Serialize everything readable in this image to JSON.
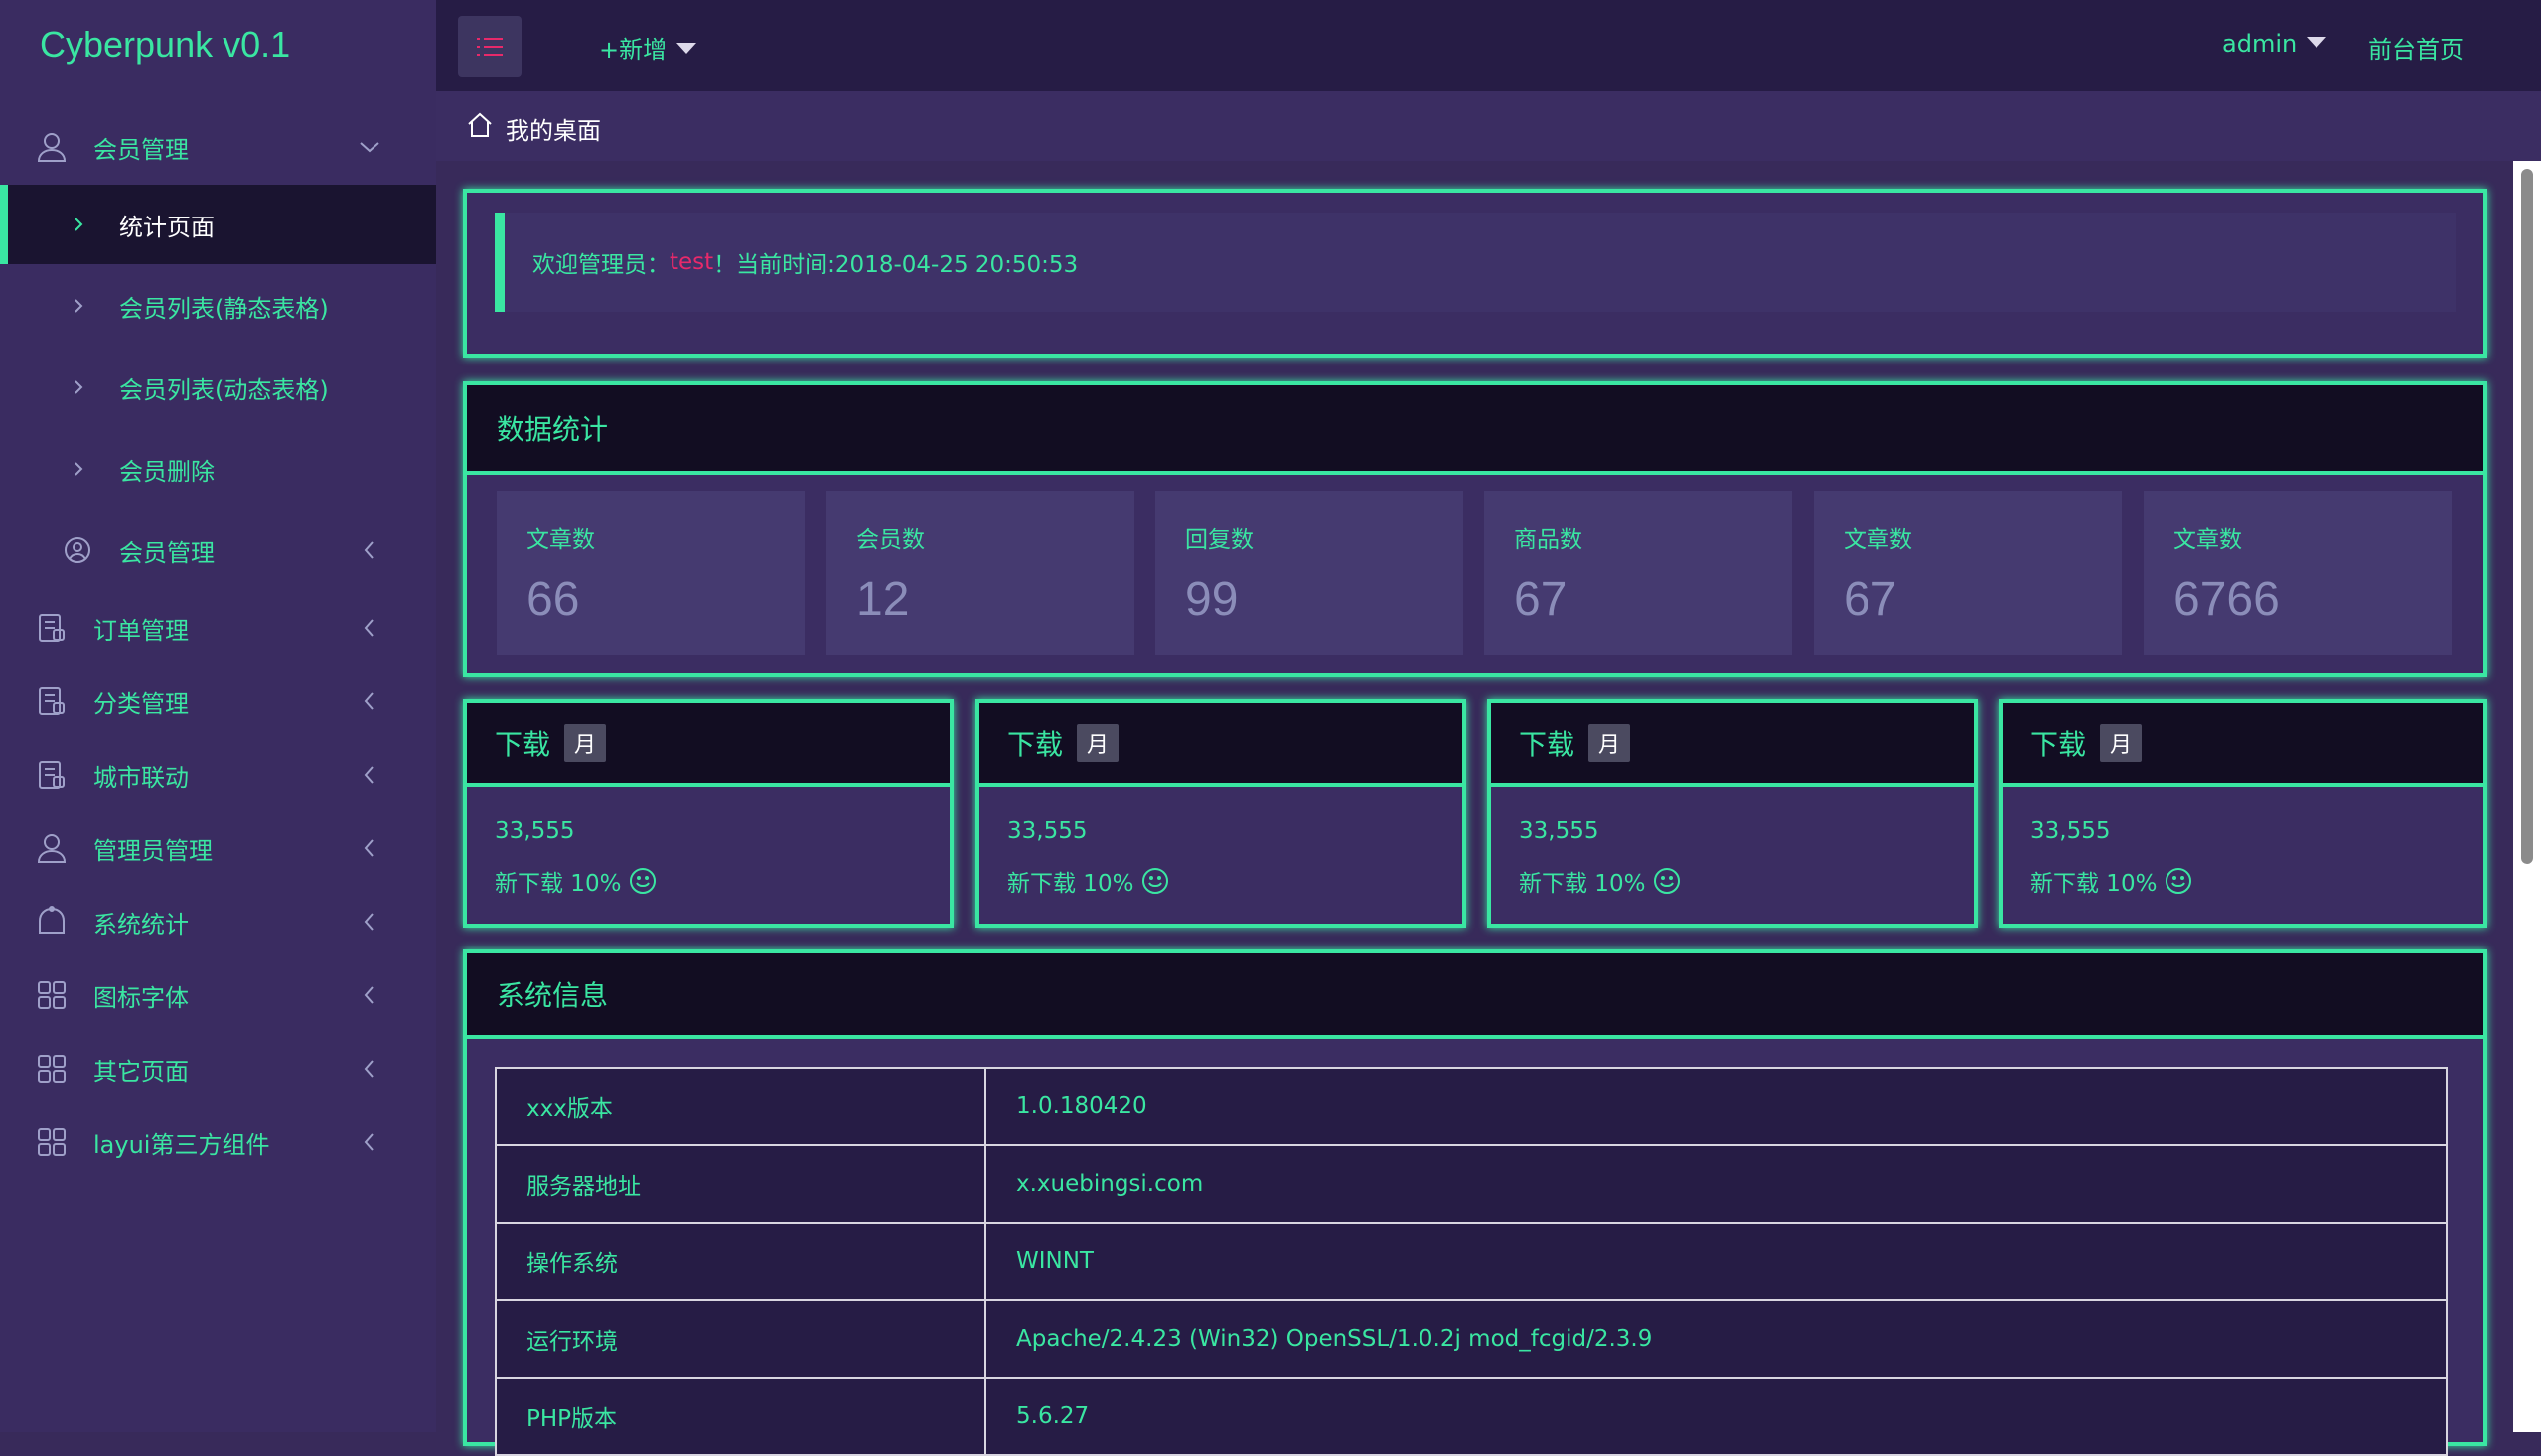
{
  "app": {
    "title": "Cyberpunk v0.1"
  },
  "topbar": {
    "add_label": "+新增",
    "user_label": "admin",
    "frontend_label": "前台首页"
  },
  "breadcrumb": {
    "label": "我的桌面"
  },
  "sidebar": {
    "items": [
      {
        "label": "会员管理",
        "icon": "user-icon"
      },
      {
        "label": "统计页面"
      },
      {
        "label": "会员列表(静态表格)"
      },
      {
        "label": "会员列表(动态表格)"
      },
      {
        "label": "会员删除"
      },
      {
        "label": "会员管理",
        "icon": "user-circle-icon"
      },
      {
        "label": "订单管理",
        "icon": "order-icon"
      },
      {
        "label": "分类管理",
        "icon": "category-icon"
      },
      {
        "label": "城市联动",
        "icon": "city-icon"
      },
      {
        "label": "管理员管理",
        "icon": "admin-icon"
      },
      {
        "label": "系统统计",
        "icon": "stats-icon"
      },
      {
        "label": "图标字体",
        "icon": "grid-icon"
      },
      {
        "label": "其它页面",
        "icon": "grid-icon"
      },
      {
        "label": "layui第三方组件",
        "icon": "grid-icon"
      }
    ]
  },
  "welcome": {
    "prefix": "欢迎管理员：",
    "user": "test",
    "suffix": "！当前时间:2018-04-25 20:50:53"
  },
  "stats": {
    "title": "数据统计",
    "cards": [
      {
        "name": "文章数",
        "value": "66"
      },
      {
        "name": "会员数",
        "value": "12"
      },
      {
        "name": "回复数",
        "value": "99"
      },
      {
        "name": "商品数",
        "value": "67"
      },
      {
        "name": "文章数",
        "value": "67"
      },
      {
        "name": "文章数",
        "value": "6766"
      }
    ]
  },
  "downloads": [
    {
      "title": "下载",
      "badge": "月",
      "count": "33,555",
      "pct": "新下载 10%"
    },
    {
      "title": "下载",
      "badge": "月",
      "count": "33,555",
      "pct": "新下载 10%"
    },
    {
      "title": "下载",
      "badge": "月",
      "count": "33,555",
      "pct": "新下载 10%"
    },
    {
      "title": "下载",
      "badge": "月",
      "count": "33,555",
      "pct": "新下载 10%"
    }
  ],
  "sysinfo": {
    "title": "系统信息",
    "rows": [
      {
        "key": "xxx版本",
        "value": "1.0.180420"
      },
      {
        "key": "服务器地址",
        "value": "x.xuebingsi.com"
      },
      {
        "key": "操作系统",
        "value": "WINNT"
      },
      {
        "key": "运行环境",
        "value": "Apache/2.4.23 (Win32) OpenSSL/1.0.2j mod_fcgid/2.3.9"
      },
      {
        "key": "PHP版本",
        "value": "5.6.27"
      }
    ]
  },
  "colors": {
    "accent": "#3ae6a2",
    "highlight": "#e8296a",
    "sidebar_bg": "#3a2c61",
    "topbar_bg": "#261c45"
  }
}
